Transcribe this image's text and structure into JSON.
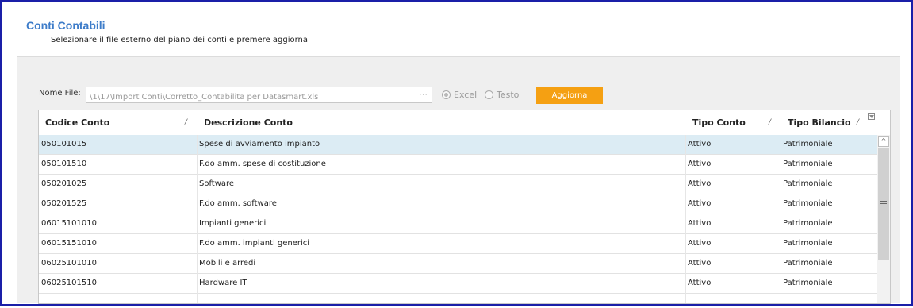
{
  "header": {
    "title": "Conti Contabili",
    "subtitle": "Selezionare il file esterno del piano dei conti e premere aggiorna"
  },
  "file": {
    "label": "Nome File:",
    "value": "\\1\\17\\Import Conti\\Corretto_Contabilita per Datasmart.xls",
    "browse_label": "⋯"
  },
  "format": {
    "excel_label": "Excel",
    "testo_label": "Testo",
    "selected": "Excel"
  },
  "refresh_button": {
    "label": "Aggiorna"
  },
  "colors": {
    "accent": "#f5a012",
    "title": "#3d7cc9",
    "frame": "#1a1fa8",
    "selected_row": "#dcecf4"
  },
  "grid": {
    "columns": [
      {
        "label": "Codice Conto",
        "sort_glyph": "/"
      },
      {
        "label": "Descrizione Conto",
        "sort_glyph": ""
      },
      {
        "label": "Tipo Conto",
        "sort_glyph": "/"
      },
      {
        "label": "Tipo Bilancio",
        "sort_glyph": "/"
      }
    ],
    "rows": [
      [
        "050101015",
        "Spese di avviamento impianto",
        "Attivo",
        "Patrimoniale"
      ],
      [
        "050101510",
        "F.do amm. spese di costituzione",
        "Attivo",
        "Patrimoniale"
      ],
      [
        "050201025",
        "Software",
        "Attivo",
        "Patrimoniale"
      ],
      [
        "050201525",
        "F.do amm. software",
        "Attivo",
        "Patrimoniale"
      ],
      [
        "06015101010",
        "Impianti generici",
        "Attivo",
        "Patrimoniale"
      ],
      [
        "06015151010",
        "F.do amm. impianti generici",
        "Attivo",
        "Patrimoniale"
      ],
      [
        "06025101010",
        "Mobili e arredi",
        "Attivo",
        "Patrimoniale"
      ],
      [
        "06025101510",
        "Hardware IT",
        "Attivo",
        "Patrimoniale"
      ]
    ],
    "selected_row": 0
  },
  "scrollbar": {
    "up_glyph": "^",
    "grip_icon": "grip-icon"
  }
}
